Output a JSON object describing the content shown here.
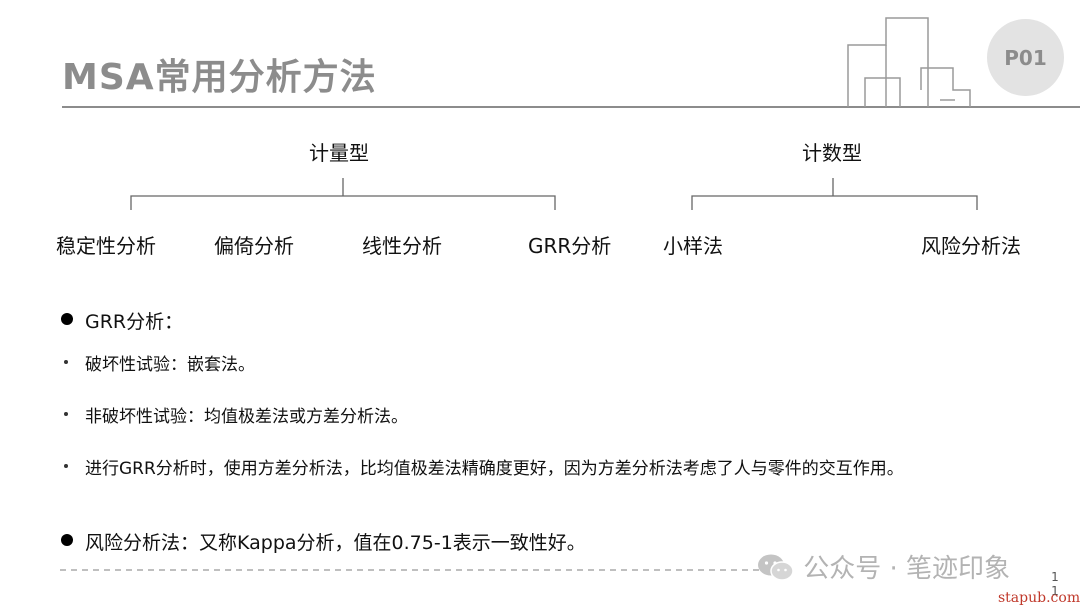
{
  "header": {
    "title": "MSA常用分析方法",
    "badge": "P01"
  },
  "tree": {
    "variable": {
      "label": "计量型",
      "methods": [
        "稳定性分析",
        "偏倚分析",
        "线性分析",
        "GRR分析"
      ]
    },
    "attribute": {
      "label": "计数型",
      "methods": [
        "小样法",
        "风险分析法"
      ]
    }
  },
  "notes": {
    "grr_heading": "GRR分析：",
    "grr_items": [
      "破坏性试验：嵌套法。",
      "非破坏性试验：均值极差法或方差分析法。",
      "进行GRR分析时，使用方差分析法，比均值极差法精确度更好，因为方差分析法考虑了人与零件的交互作用。"
    ],
    "risk": "风险分析法：又称Kappa分析，值在0.75-1表示一致性好。"
  },
  "footer": {
    "watermark": "公众号 · 笔迹印象",
    "source": "stapub.com",
    "page_number": "1\n1"
  }
}
